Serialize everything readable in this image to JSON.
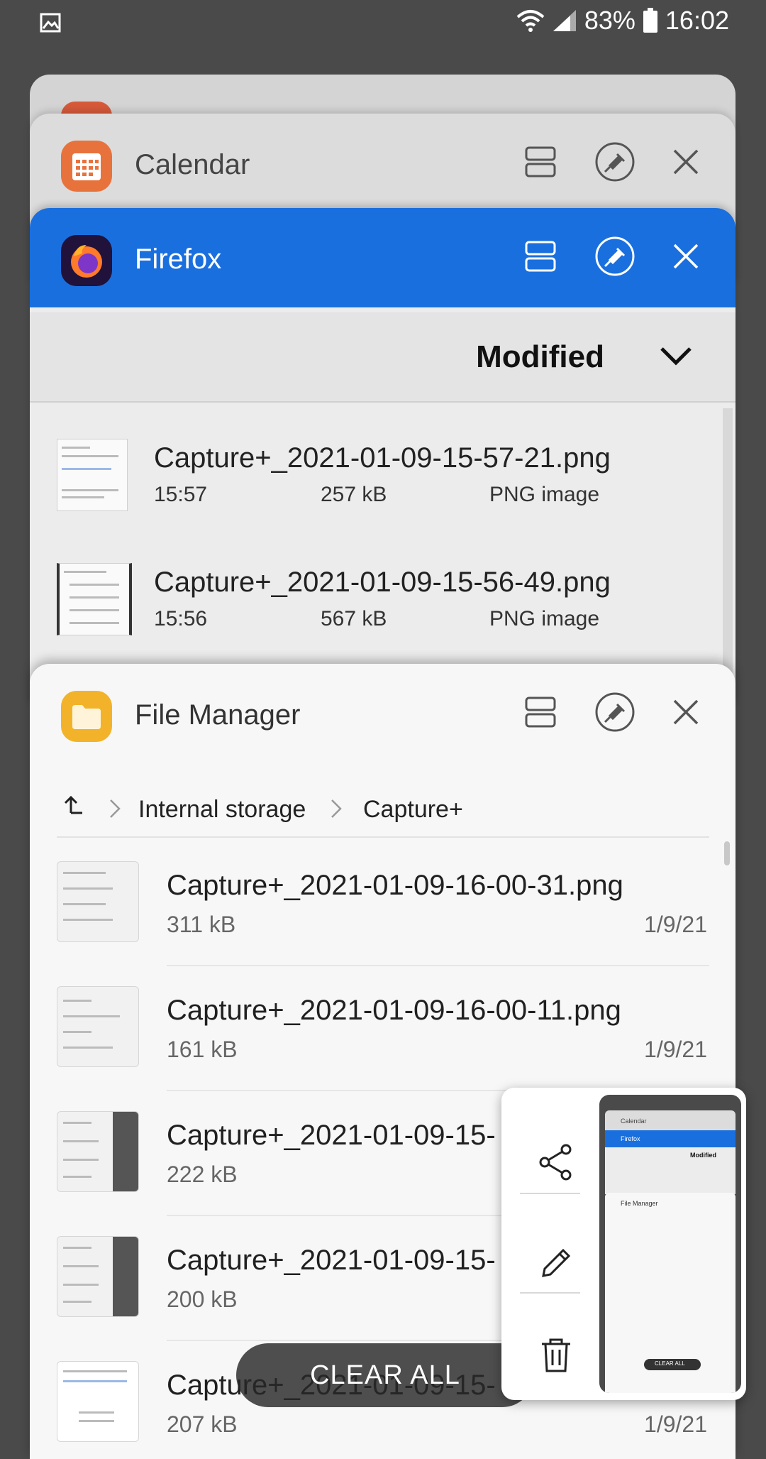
{
  "status_bar": {
    "battery": "83%",
    "time": "16:02"
  },
  "colors": {
    "firefox_blue": "#1a6fde",
    "calendar_orange": "#e8723c",
    "file_manager_yellow": "#f2b32a"
  },
  "cards": {
    "calendar": {
      "title": "Calendar",
      "icon": "calendar-icon"
    },
    "firefox": {
      "title": "Firefox",
      "icon": "firefox-icon",
      "sort_label": "Modified",
      "files": [
        {
          "name": "Capture+_2021-01-09-15-57-21.png",
          "time": "15:57",
          "size": "257 kB",
          "type": "PNG image"
        },
        {
          "name": "Capture+_2021-01-09-15-56-49.png",
          "time": "15:56",
          "size": "567 kB",
          "type": "PNG image"
        }
      ]
    },
    "file_manager": {
      "title": "File Manager",
      "icon": "folder-icon",
      "breadcrumb": [
        "Internal storage",
        "Capture+"
      ],
      "files": [
        {
          "name": "Capture+_2021-01-09-16-00-31.png",
          "size": "311 kB",
          "date": "1/9/21"
        },
        {
          "name": "Capture+_2021-01-09-16-00-11.png",
          "size": "161 kB",
          "date": "1/9/21"
        },
        {
          "name": "Capture+_2021-01-09-15-",
          "size": "222 kB",
          "date": ""
        },
        {
          "name": "Capture+_2021-01-09-15-",
          "size": "200 kB",
          "date": ""
        },
        {
          "name": "Capture+_2021-01-09-15-",
          "size": "207 kB",
          "date": "1/9/21"
        }
      ]
    }
  },
  "clear_all_label": "CLEAR ALL",
  "screenshot_popup": {
    "actions": [
      "share-icon",
      "edit-icon",
      "delete-icon"
    ],
    "preview": {
      "calendar": "Calendar",
      "firefox": "Firefox",
      "modified": "Modified",
      "file_manager": "File Manager",
      "clear_all": "CLEAR ALL"
    }
  }
}
